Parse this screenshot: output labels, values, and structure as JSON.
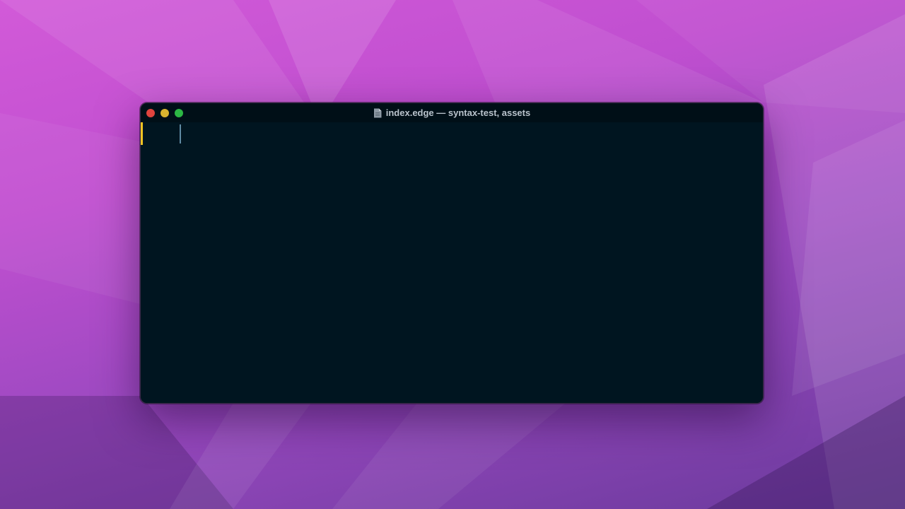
{
  "window": {
    "title": "index.edge — syntax-test, assets",
    "file_icon": "document-icon"
  },
  "traffic_lights": [
    {
      "name": "close",
      "color": "#e0443e"
    },
    {
      "name": "minimize",
      "color": "#dab42f"
    },
    {
      "name": "maximize",
      "color": "#2cb744"
    }
  ],
  "editor": {
    "background": "#001520",
    "line_marker_color": "#f2c522",
    "cursor_color": "#5f8aa3",
    "content": ""
  }
}
